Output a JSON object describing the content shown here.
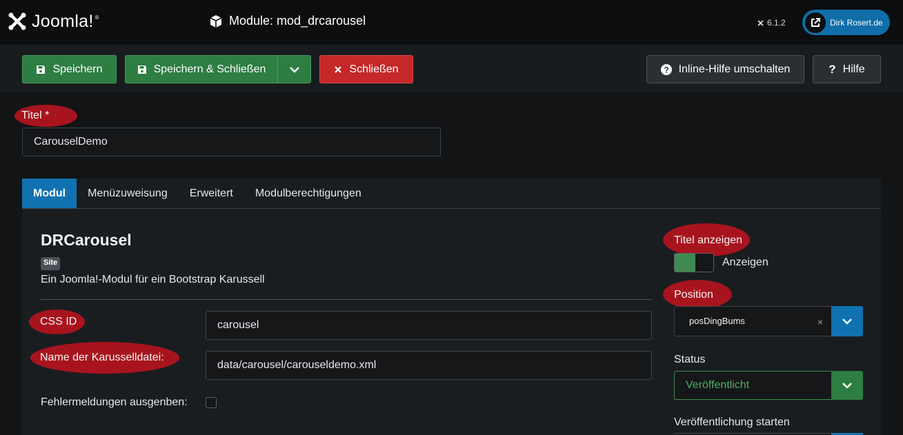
{
  "header": {
    "brand": "Joomla!",
    "brand_mark": "®",
    "page_title": "Module: mod_drcarousel",
    "version": "6.1.2",
    "site_link_label": "Dirk Rosert.de"
  },
  "toolbar": {
    "save": "Speichern",
    "save_close": "Speichern & Schließen",
    "close": "Schließen",
    "inline_help": "Inline-Hilfe umschalten",
    "help": "Hilfe"
  },
  "form": {
    "title_label": "Titel *",
    "title_value": "CarouselDemo"
  },
  "tabs": [
    {
      "label": "Modul"
    },
    {
      "label": "Menüzuweisung"
    },
    {
      "label": "Erweitert"
    },
    {
      "label": "Modulberechtigungen"
    }
  ],
  "module": {
    "name": "DRCarousel",
    "badge": "Site",
    "description": "Ein Joomla!-Modul für ein Bootstrap Karussell",
    "css_id_label": "CSS ID",
    "css_id_value": "carousel",
    "file_label": "Name der Karusselldatei:",
    "file_value": "data/carousel/carouseldemo.xml",
    "errors_label": "Fehlermeldungen ausgenben:"
  },
  "sidebar": {
    "show_title_label": "Titel anzeigen",
    "show_title_toggle": "Anzeigen",
    "position_label": "Position",
    "position_value": "posDingBums",
    "clear_symbol": "×",
    "status_label": "Status",
    "status_value": "Veröffentlicht",
    "publish_start_label": "Veröffentlichung starten"
  },
  "colors": {
    "accent_blue": "#1172b1",
    "success_green": "#2e7d43",
    "danger_red": "#c52828",
    "highlight_ellipse": "#a8141e"
  }
}
